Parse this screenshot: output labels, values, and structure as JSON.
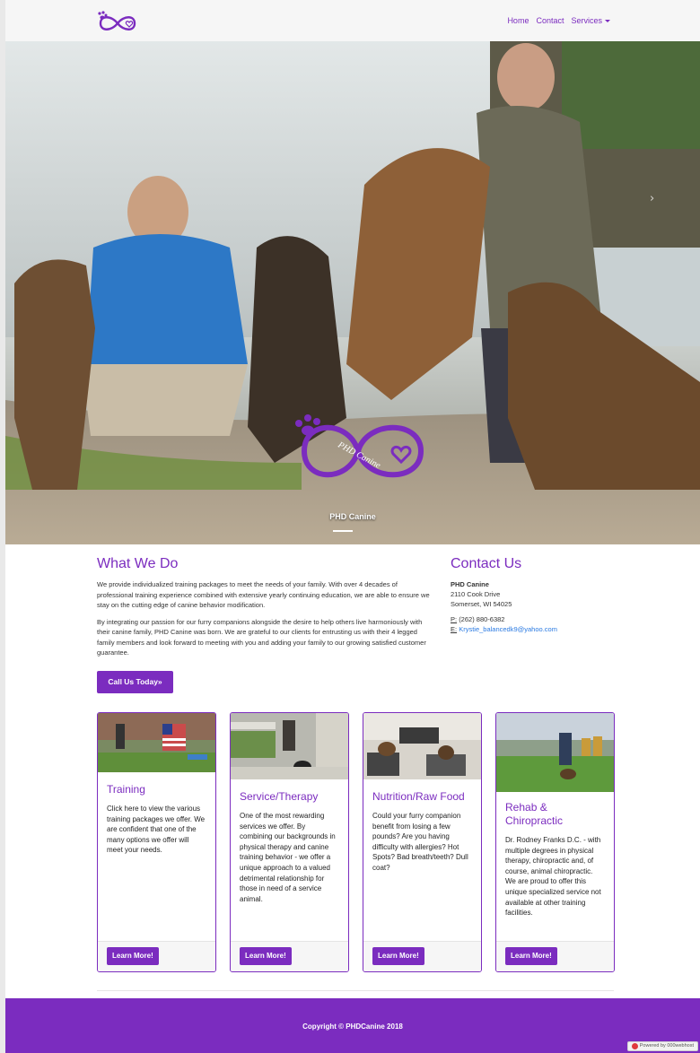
{
  "nav": {
    "items": [
      "Home",
      "Contact",
      "Services"
    ]
  },
  "hero": {
    "caption": "PHD Canine",
    "logo_text": "PHD Canine"
  },
  "what_we_do": {
    "heading": "What We Do",
    "paragraphs": [
      "We provide individualized training packages to meet the needs of your family. With over 4 decades of professional training experience combined with extensive yearly continuing education, we are able to ensure we stay on the cutting edge of canine behavior modification.",
      "By integrating our passion for our furry companions alongside the desire to help others live harmoniously with their canine family, PHD Canine was born. We are grateful to our clients for entrusting us with their 4 legged family members and look forward to meeting with you and adding your family to our growing satisfied customer guarantee."
    ],
    "button": "Call Us Today»"
  },
  "contact": {
    "heading": "Contact Us",
    "name": "PHD Canine",
    "street": "2110 Cook Drive",
    "city": "Somerset, WI 54025",
    "phone_label": "P:",
    "phone": "(262) 880-6382",
    "email_label": "E:",
    "email": "Krystie_balancedk9@yahoo.com"
  },
  "cards": [
    {
      "title": "Training",
      "description": "Click here to view the various training packages we offer. We are confident that one of the many options we offer will meet your needs.",
      "button": "Learn More!"
    },
    {
      "title": "Service/Therapy",
      "description": "One of the most rewarding services we offer. By combining our backgrounds in physical therapy and canine training behavior - we offer a unique approach to a valued detrimental relationship for those in need of a service animal.",
      "button": "Learn More!"
    },
    {
      "title": "Nutrition/Raw Food",
      "description": "Could your furry companion benefit from losing a few pounds? Are you having difficulty with allergies? Hot Spots? Bad breath/teeth? Dull coat?",
      "button": "Learn More!"
    },
    {
      "title": "Rehab & Chiropractic",
      "description": "Dr. Rodney Franks D.C. - with multiple degrees in physical therapy, chiropractic and, of course, animal chiropractic. We are proud to offer this unique specialized service not available at other training facilities.",
      "button": "Learn More!"
    }
  ],
  "footer": {
    "copyright": "Copyright © PHDCanine 2018",
    "badge": "Powered by 000webhost"
  },
  "colors": {
    "brand_purple": "#7b2cbf",
    "link_blue": "#2a7ae2"
  },
  "icons": [
    "paw-infinity-logo-icon",
    "caret-down-icon",
    "carousel-next-icon"
  ]
}
